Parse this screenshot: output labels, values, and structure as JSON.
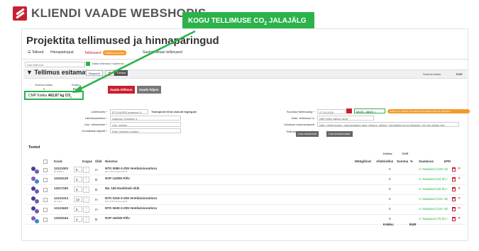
{
  "header": {
    "brand": "KLIENDI VAADE WEBSHOPIS"
  },
  "callout": {
    "text_main": "KOGU TELLIMUSE CO",
    "text_sub": "2",
    "text_tail": " JALAJÄLG"
  },
  "page": {
    "title": "Projektita tellimused ja hinnapäringud"
  },
  "tabs": [
    {
      "label": "Tellised"
    },
    {
      "label": "Hinnapäringud"
    },
    {
      "label": "Tellimused",
      "badge": "Tellimus pooleli"
    },
    {
      "label": "Sastrid ostuari tellimused"
    }
  ],
  "filter": {
    "placeholder": "Otsi tellimust",
    "checkbox_label": "Näita tellimuse hüpelmist"
  },
  "section": {
    "title": "Tellimus esitamata",
    "btn_export": "Ekspordi",
    "btn_delete_icon": "trash-icon",
    "btn_dark": "Tühista",
    "sum_label": "Summa kokku",
    "currency": "EUR"
  },
  "summary": {
    "sum_label": "Summa kokku",
    "sum_value": "0",
    "vat_label": "Kokku",
    "vat_value": "EUR",
    "co2_label": "CMP Kokku",
    "co2_value": "462,87 kg CO",
    "co2_sub": "2",
    "btn_submit": "Saada tellimus",
    "btn_save": "Saada hiljem"
  },
  "form_left": {
    "delivery_label": "Lähetusviis *",
    "delivery_value": "ETS-NORD transport",
    "delivery_note": "Transpordi hind osavuti tegingule",
    "address_label": "Lähetusaadress *",
    "address_value": "Aadress: Rooslinn 1",
    "contact_label": "Liini, võtmumber *",
    "contact_value": "Liini, telefon",
    "object_label": "Kontaktisik objektil *",
    "object_value": "Nimi, telefoni number"
  },
  "form_right": {
    "date_label": "Soovitud tähetusaeg *",
    "date_value": "07.04.2020",
    "time_value": "08:00 - 08:00",
    "date_note": "Tellimus on esitatud. Kontaktisik teavitatakse tellimuse täitmisest",
    "ref_label": "Viide, tellimusel nr",
    "ref_value": "NBP tellia nähtav arvel",
    "comment_label": "Lähetuse kommentaarid",
    "comment_value": "Näit. Lähetuspuhu, mahalmaaine aule nõngus, pikkus, võimalikku terva tollastad, või mis olulise info",
    "docs_label": "Tellimuse dokumendid",
    "btn_add_doc": "Lisa dokument",
    "btn_add_comment": "Lisa kommentaar"
  },
  "goods": {
    "title": "Tooted",
    "totals_header": {
      "kokku": "Kokku:",
      "eur": "EUR"
    },
    "columns": [
      "Kood",
      "Kogus",
      "Ühik",
      "Nimetus",
      "Müügihind",
      "Allahindlus",
      "Summa",
      "%",
      "Saadavus",
      "EPD"
    ],
    "rows": [
      {
        "code": "12121003",
        "sub": "ET-0080-3",
        "qty": "5",
        "unit": "m",
        "name": "NTO 0080-3-Z05 Ventilatsioonitoru",
        "name_sub": "NPL 080 Dupland (ENI)",
        "sum": "0",
        "avail": "Saadaval (100 m)"
      },
      {
        "code": "12202129",
        "sub": "",
        "qty": "5",
        "unit": "tk",
        "name": "NVP 125/90 Põlv",
        "name_sub": "",
        "sum": "0",
        "avail": "Saadaval (94 tk)"
      },
      {
        "code": "13217160",
        "sub": "",
        "qty": "8",
        "unit": "tk",
        "name": "NIL 160 Ikoeltimik ühik",
        "name_sub": "",
        "sum": "0",
        "avail": "Saadaval (56 tk)"
      },
      {
        "code": "12121313",
        "sub": "ET-0315",
        "qty": "12",
        "unit": "m",
        "name": "NTO 0315-3-Z05 Ventilatsioonitoru",
        "name_sub": "NPL 315 Dupland (ENI)",
        "sum": "0",
        "avail": "Saadaval (231 m)"
      },
      {
        "code": "12121633",
        "sub": "",
        "qty": "5",
        "unit": "m",
        "name": "NTO 0630-3-Z05 Ventilatsioonitoru",
        "name_sub": "",
        "sum": "0",
        "avail": "Saadaval (231 m)"
      },
      {
        "code": "12202164",
        "sub": "",
        "qty": "4",
        "unit": "tk",
        "name": "NVP 160/45 Põlv",
        "name_sub": "",
        "sum": "0",
        "avail": "Saadaval (78 tk)"
      }
    ],
    "footer": {
      "kokku": "Kokku:",
      "eur": "EUR"
    }
  },
  "colors": {
    "brand_red": "#c8202f",
    "callout_green": "#2bb34a",
    "badge_orange": "#f39a2b"
  }
}
